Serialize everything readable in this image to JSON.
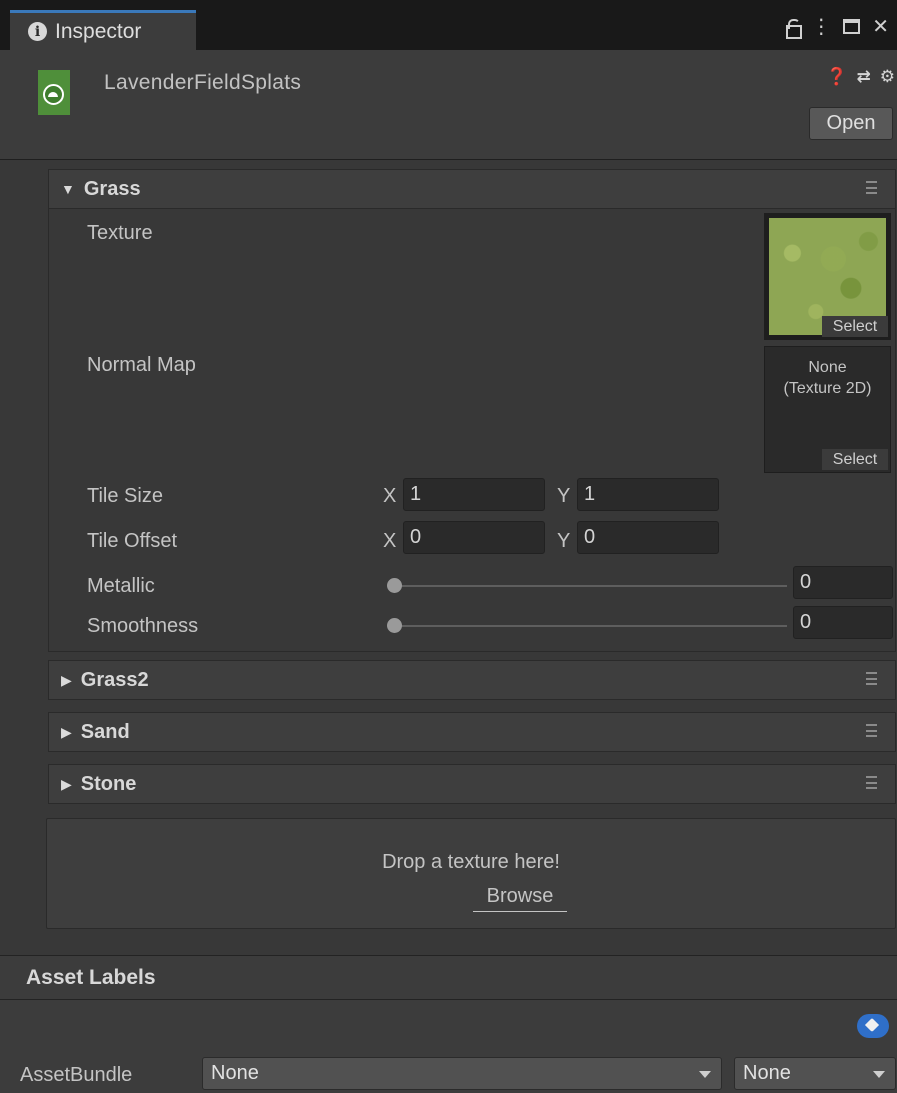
{
  "window": {
    "tab_label": "Inspector",
    "controls": [
      "lock-icon",
      "kebab-icon",
      "maximize-icon",
      "close-icon"
    ]
  },
  "header": {
    "asset_name": "LavenderFieldSplats",
    "open_label": "Open",
    "icons": [
      "help-icon",
      "presets-icon",
      "settings-icon"
    ]
  },
  "layers": [
    {
      "name": "Grass",
      "expanded": true,
      "texture_label": "Texture",
      "texture_select": "Select",
      "normal_map_label": "Normal Map",
      "normal_map_value": "None\n(Texture 2D)",
      "normal_map_select": "Select",
      "tile_size_label": "Tile Size",
      "tile_size_x": "1",
      "tile_size_y": "1",
      "tile_offset_label": "Tile Offset",
      "tile_offset_x": "0",
      "tile_offset_y": "0",
      "metallic_label": "Metallic",
      "metallic_value": "0",
      "smoothness_label": "Smoothness",
      "smoothness_value": "0",
      "axis_x": "X",
      "axis_y": "Y"
    },
    {
      "name": "Grass2",
      "expanded": false
    },
    {
      "name": "Sand",
      "expanded": false
    },
    {
      "name": "Stone",
      "expanded": false
    }
  ],
  "drop_zone": {
    "text": "Drop a texture here!",
    "browse_label": "Browse"
  },
  "asset_labels": {
    "title": "Asset Labels",
    "bundle_label": "AssetBundle",
    "bundle_value": "None",
    "variant_value": "None"
  },
  "colors": {
    "accent": "#3a79bb",
    "tag": "#2f6fc9",
    "panel": "#383838"
  }
}
